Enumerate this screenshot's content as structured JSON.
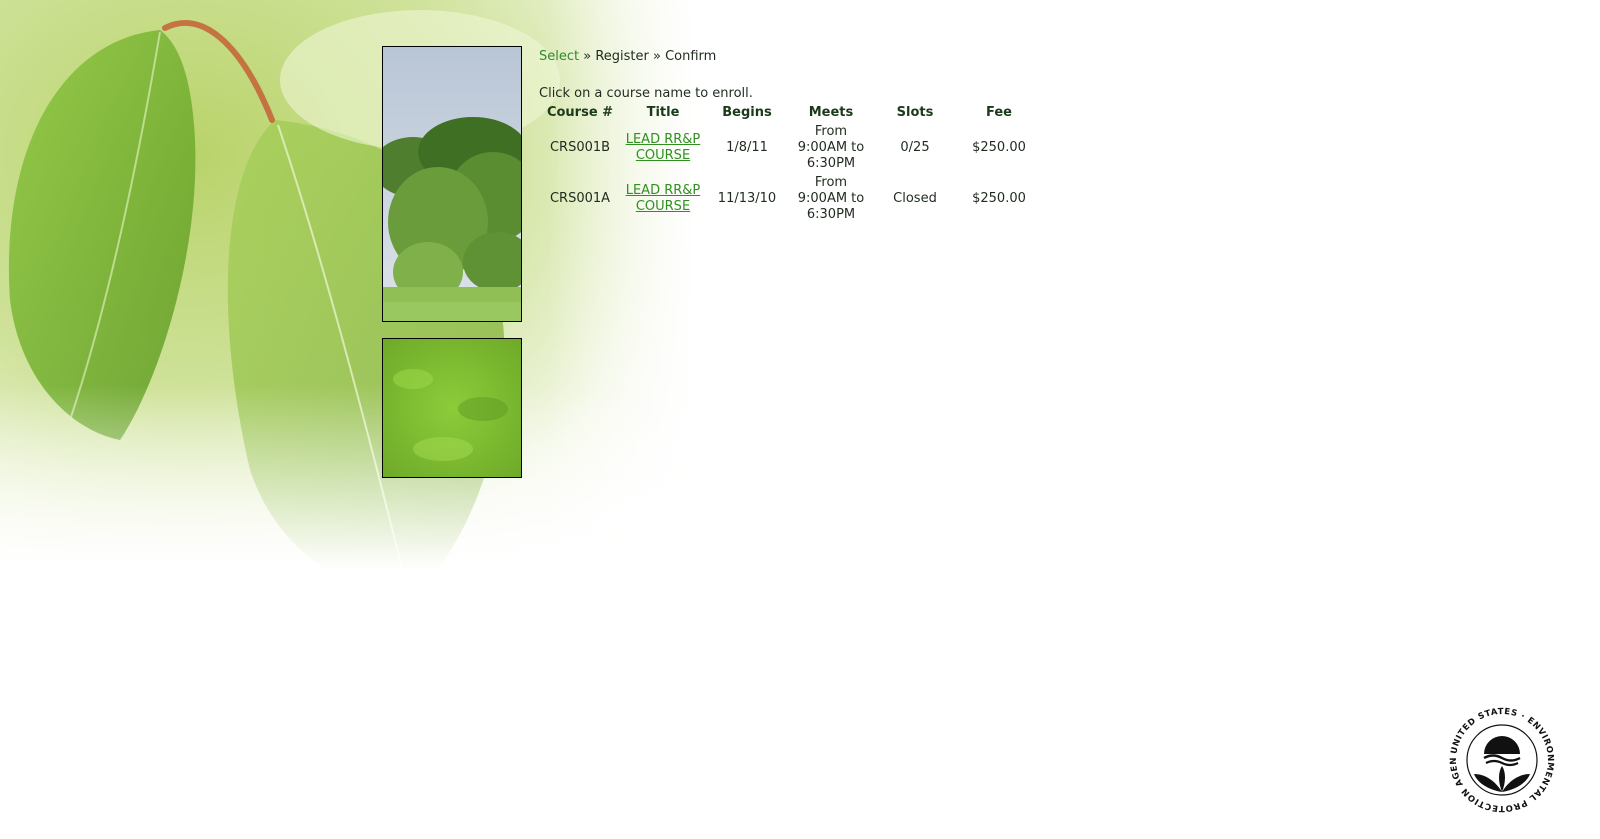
{
  "breadcrumb": {
    "step1": "Select",
    "sep1": " » ",
    "step2": "Register",
    "sep2": " » ",
    "step3": "Confirm"
  },
  "instructions": "Click on a course name to enroll.",
  "table": {
    "headers": {
      "course_num": "Course #",
      "title": "Title",
      "begins": "Begins",
      "meets": "Meets",
      "slots": "Slots",
      "fee": "Fee"
    },
    "rows": [
      {
        "course_num": "CRS001B",
        "title_line1": "LEAD RR&P",
        "title_line2": "COURSE",
        "begins": "1/8/11",
        "meets_line1": "From",
        "meets_line2": "9:00AM to",
        "meets_line3": "6:30PM",
        "slots": "0/25",
        "fee": "$250.00"
      },
      {
        "course_num": "CRS001A",
        "title_line1": "LEAD RR&P",
        "title_line2": "COURSE",
        "begins": "11/13/10",
        "meets_line1": "From",
        "meets_line2": "9:00AM to",
        "meets_line3": "6:30PM",
        "slots": "Closed",
        "fee": "$250.00"
      }
    ]
  },
  "seal": {
    "text": "UNITED STATES · ENVIRONMENTAL PROTECTION AGENCY",
    "icon": "epa-seal-icon"
  },
  "colors": {
    "breadcrumb_active": "#2e8b2e",
    "link": "#2f8f1f",
    "header_text": "#1b3a1b",
    "body_text": "#1f2b1f"
  }
}
